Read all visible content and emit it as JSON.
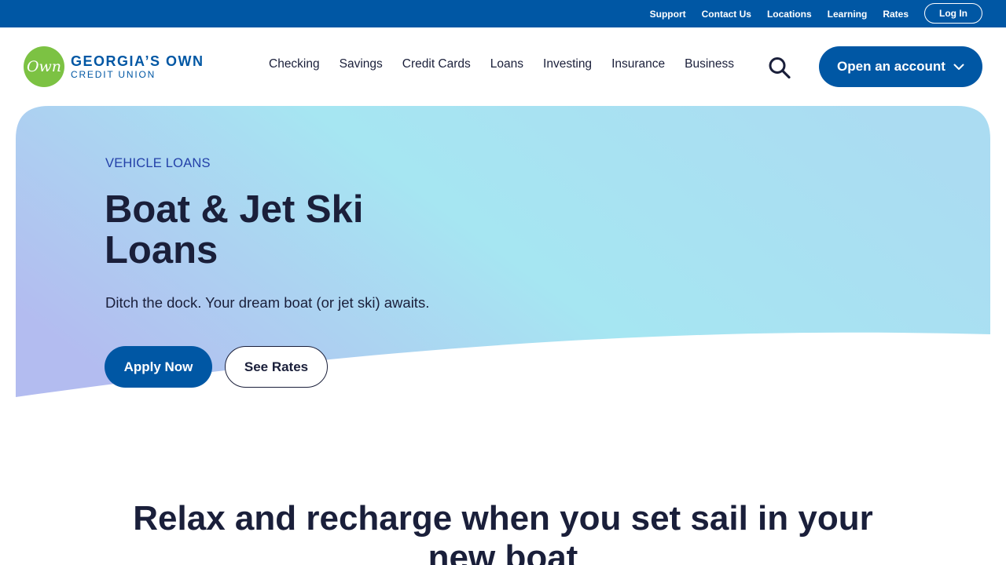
{
  "utility": {
    "links": [
      "Support",
      "Contact Us",
      "Locations",
      "Learning",
      "Rates"
    ],
    "login_label": "Log In"
  },
  "brand": {
    "logo_mark": "Own",
    "name_line1": "GEORGIA’S OWN",
    "name_line2": "CREDIT UNION"
  },
  "nav": {
    "items": [
      "Checking",
      "Savings",
      "Credit Cards",
      "Loans",
      "Investing",
      "Insurance",
      "Business"
    ],
    "open_account_label": "Open an account"
  },
  "hero": {
    "eyebrow": "VEHICLE LOANS",
    "title": "Boat & Jet Ski Loans",
    "subtitle": "Ditch the dock. Your dream boat (or jet ski) awaits.",
    "primary_cta": "Apply Now",
    "secondary_cta": "See Rates"
  },
  "section": {
    "heading": "Relax and recharge when you set sail in your new boat"
  },
  "icons": {
    "search": "search-icon",
    "chevron": "chevron-down-icon"
  },
  "colors": {
    "brand_blue": "#0057a4",
    "logo_green": "#7cc243",
    "text_dark": "#1a1f3a",
    "eyebrow_blue": "#2340a8",
    "hero_gradient_start": "#b3bcf0",
    "hero_gradient_end": "#a6e6f2"
  }
}
